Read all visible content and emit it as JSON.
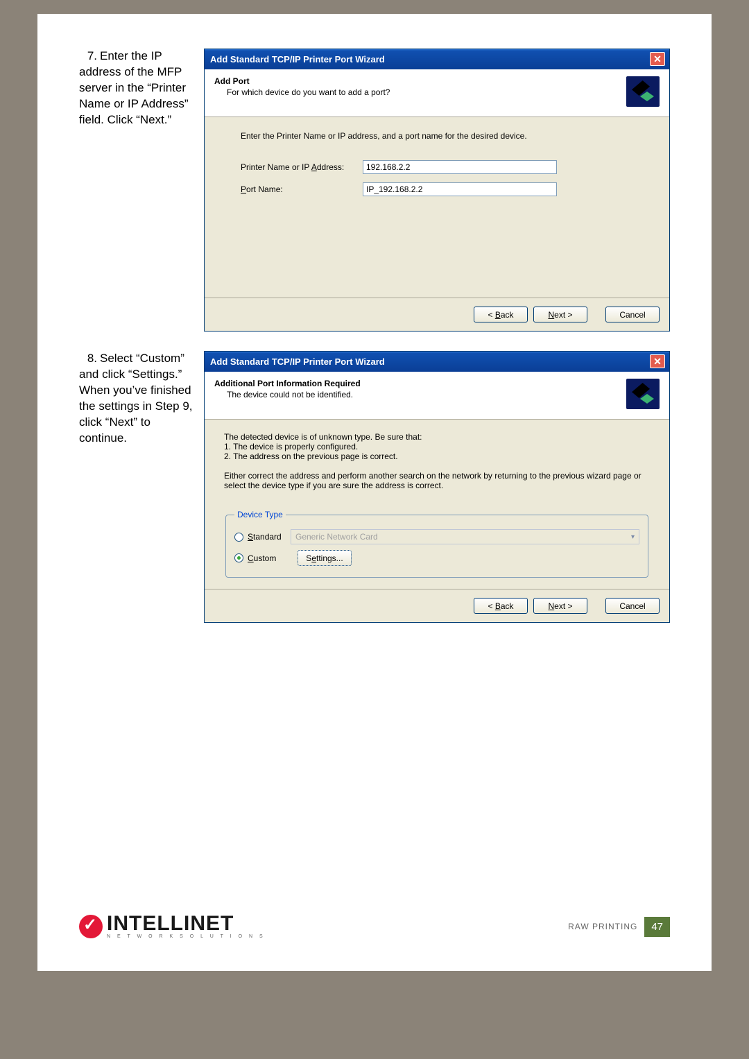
{
  "step7": {
    "number": "7.",
    "text": "Enter the IP address of the MFP server in the “Printer Name or IP Address” field. Click “Next.”"
  },
  "step8": {
    "number": "8.",
    "text": "Select “Custom” and click “Settings.” When you’ve finished the settings in Step 9, click “Next” to continue."
  },
  "dlg1": {
    "title": "Add Standard TCP/IP Printer Port Wizard",
    "head_title": "Add Port",
    "head_sub": "For which device do you want to add a port?",
    "instr": "Enter the Printer Name or IP address, and a port name for the desired device.",
    "lbl_printer_pre": "Printer Name or IP ",
    "lbl_printer_u": "A",
    "lbl_printer_post": "ddress:",
    "val_printer": "192.168.2.2",
    "lbl_port_u": "P",
    "lbl_port_post": "ort Name:",
    "val_port": "IP_192.168.2.2",
    "btn_back_pre": "< ",
    "btn_back_u": "B",
    "btn_back_post": "ack",
    "btn_next_u": "N",
    "btn_next_post": "ext >",
    "btn_cancel": "Cancel"
  },
  "dlg2": {
    "title": "Add Standard TCP/IP Printer Port Wizard",
    "head_title": "Additional Port Information Required",
    "head_sub": "The device could not be identified.",
    "para1": "The detected device is of unknown type.  Be sure that:",
    "li1": "1.  The device is properly configured.",
    "li2": "2.  The address on the previous page is correct.",
    "para2": "Either correct the address and perform another search on the network by returning to the previous wizard page or select the device type if you are sure the address is correct.",
    "legend": "Device Type",
    "radio_std_u": "S",
    "radio_std_post": "tandard",
    "combo_value": "Generic Network Card",
    "radio_cust_u": "C",
    "radio_cust_post": "ustom",
    "btn_settings_pre": "S",
    "btn_settings_u": "e",
    "btn_settings_post": "ttings...",
    "btn_back_pre": "< ",
    "btn_back_u": "B",
    "btn_back_post": "ack",
    "btn_next_u": "N",
    "btn_next_post": "ext >",
    "btn_cancel": "Cancel"
  },
  "footer": {
    "brand": "INTELLINET",
    "brand_sub": "N E T W O R K   S O L U T I O N S",
    "section": "RAW PRINTING",
    "page": "47"
  }
}
